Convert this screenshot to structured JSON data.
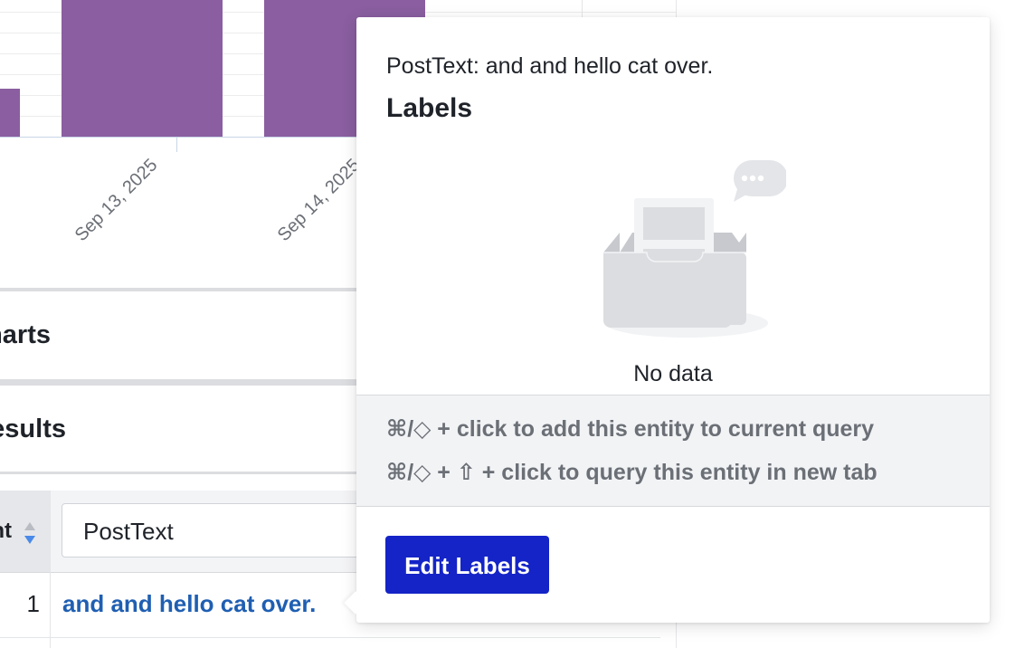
{
  "chart": {
    "tick_labels": [
      "Sep 13, 2025",
      "Sep 14, 2025"
    ]
  },
  "sections": {
    "charts_title": "Charts",
    "results_title": "Results"
  },
  "table": {
    "count_header": "Count",
    "posttext_filter_value": "PostText",
    "rows": [
      {
        "count": "1",
        "posttext": "and and hello cat over."
      }
    ]
  },
  "popover": {
    "posttext_line": "PostText: and and hello cat over.",
    "labels_title": "Labels",
    "empty_text": "No data",
    "hints": [
      "⌘/◇ + click to add this entity to current query",
      "⌘/◇ + ⇧ + click to query this entity in new tab"
    ],
    "edit_button_label": "Edit Labels",
    "empty_icon": "empty-inbox-icon"
  },
  "colors": {
    "bar": "#8a5ea0",
    "link": "#1f5fb2",
    "primary_button": "#1424c7"
  }
}
